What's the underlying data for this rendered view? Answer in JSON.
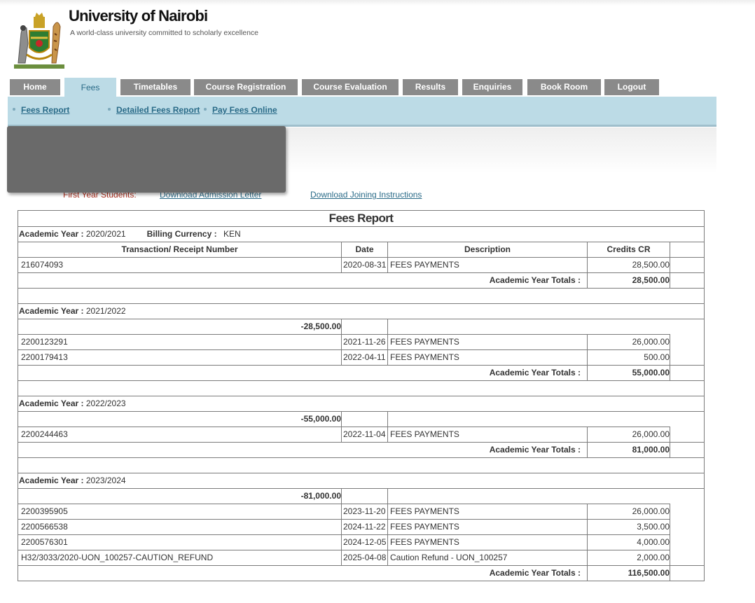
{
  "header": {
    "title": "University of Nairobi",
    "tagline": "A world-class university committed to scholarly excellence",
    "logo_icon": "coat-of-arms-icon"
  },
  "nav": {
    "tabs": [
      {
        "label": "Home",
        "active": false
      },
      {
        "label": "Fees",
        "active": true
      },
      {
        "label": "Timetables",
        "active": false
      },
      {
        "label": "Course Registration",
        "active": false
      },
      {
        "label": "Course Evaluation",
        "active": false
      },
      {
        "label": "Results",
        "active": false
      },
      {
        "label": "Enquiries",
        "active": false
      },
      {
        "label": "Book Room",
        "active": false
      },
      {
        "label": "Logout",
        "active": false
      }
    ]
  },
  "subnav": {
    "links": [
      "Fees Report",
      "Detailed Fees Report",
      "Pay Fees Online"
    ]
  },
  "notice": {
    "first_year_label": "First Year Students:",
    "download_joining": "Download Joining Instructions"
  },
  "report": {
    "title": "Fees Report",
    "academic_year_label": "Academic Year :",
    "billing_currency_label": "Billing Currency :",
    "billing_currency": "KEN",
    "columns": [
      "Transaction/ Receipt Number",
      "Date",
      "Description",
      "Credits CR"
    ],
    "totals_label": "Academic Year Totals :",
    "years": [
      {
        "year": "2020/2021",
        "opening": "",
        "rows": [
          {
            "receipt": "216074093",
            "date": "2020-08-31",
            "description": "FEES PAYMENTS",
            "credit": "28,500.00"
          }
        ],
        "total": "28,500.00"
      },
      {
        "year": "2021/2022",
        "opening": "-28,500.00",
        "rows": [
          {
            "receipt": "2200123291",
            "date": "2021-11-26",
            "description": "FEES PAYMENTS",
            "credit": "26,000.00"
          },
          {
            "receipt": "2200179413",
            "date": "2022-04-11",
            "description": "FEES PAYMENTS",
            "credit": "500.00"
          }
        ],
        "total": "55,000.00"
      },
      {
        "year": "2022/2023",
        "opening": "-55,000.00",
        "rows": [
          {
            "receipt": "2200244463",
            "date": "2022-11-04",
            "description": "FEES PAYMENTS",
            "credit": "26,000.00"
          }
        ],
        "total": "81,000.00"
      },
      {
        "year": "2023/2024",
        "opening": "-81,000.00",
        "rows": [
          {
            "receipt": "2200395905",
            "date": "2023-11-20",
            "description": "FEES PAYMENTS",
            "credit": "26,000.00"
          },
          {
            "receipt": "2200566538",
            "date": "2024-11-22",
            "description": "FEES PAYMENTS",
            "credit": "3,500.00"
          },
          {
            "receipt": "2200576301",
            "date": "2024-12-05",
            "description": "FEES PAYMENTS",
            "credit": "4,000.00"
          },
          {
            "receipt": "H32/3033/2020-UON_100257-CAUTION_REFUND",
            "date": "2025-04-08",
            "description": "Caution Refund - UON_100257",
            "credit": "2,000.00"
          }
        ],
        "total": "116,500.00"
      }
    ]
  }
}
